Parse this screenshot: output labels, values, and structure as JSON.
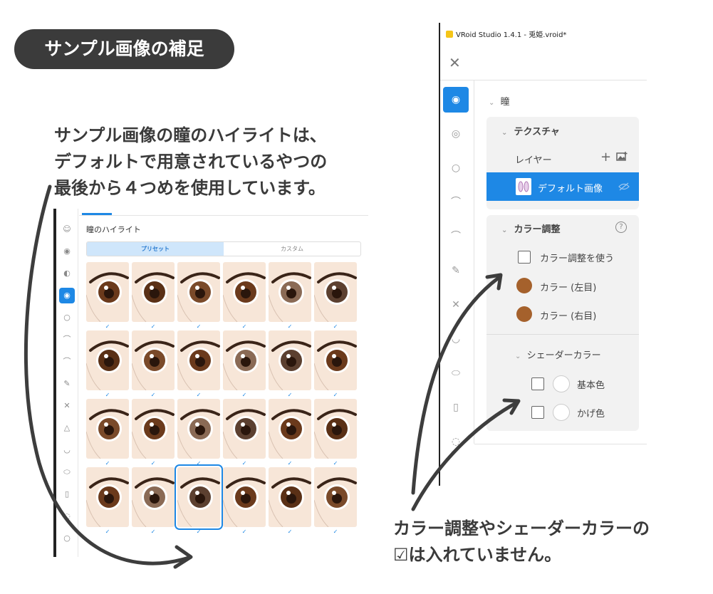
{
  "heading": "サンプル画像の補足",
  "note_left": [
    "サンプル画像の瞳のハイライトは、",
    "デフォルトで用意されているやつの",
    "最後から４つめを使用しています。"
  ],
  "note_right": [
    "カラー調整やシェーダーカラーの",
    "☑は入れていません。"
  ],
  "left_panel": {
    "title": "瞳のハイライト",
    "tabs": [
      "プリセット",
      "カスタム"
    ],
    "active_tab": 0,
    "check_mark": "✓",
    "selected_index": 20,
    "icons": [
      "face-icon",
      "eye-outline-icon",
      "iris-icon",
      "highlight-icon",
      "eye-white-icon",
      "eyebrow-icon",
      "eyelash-icon",
      "eyeliner-icon",
      "eyelid-icon",
      "nose-icon",
      "mouth-icon",
      "lips-icon",
      "teeth-icon",
      "ear-icon",
      "face-shape-icon"
    ]
  },
  "right_panel": {
    "window_title": "VRoid Studio 1.4.1 - 兎姫.vroid*",
    "close_glyph": "✕",
    "section_title": "瞳",
    "texture": {
      "title": "テクスチャ",
      "layer_label": "レイヤー",
      "add_glyph": "+",
      "layer_name": "デフォルト画像"
    },
    "color_adjust": {
      "title": "カラー調整",
      "help_glyph": "?",
      "use_label": "カラー調整を使う",
      "left_label": "カラー (左目)",
      "right_label": "カラー (右目)",
      "left_color": "#a5612c",
      "right_color": "#a5612c"
    },
    "shader": {
      "title": "シェーダーカラー",
      "base_label": "基本色",
      "shade_label": "かげ色"
    },
    "accent": "#1e88e5",
    "chevron": "⌄"
  }
}
